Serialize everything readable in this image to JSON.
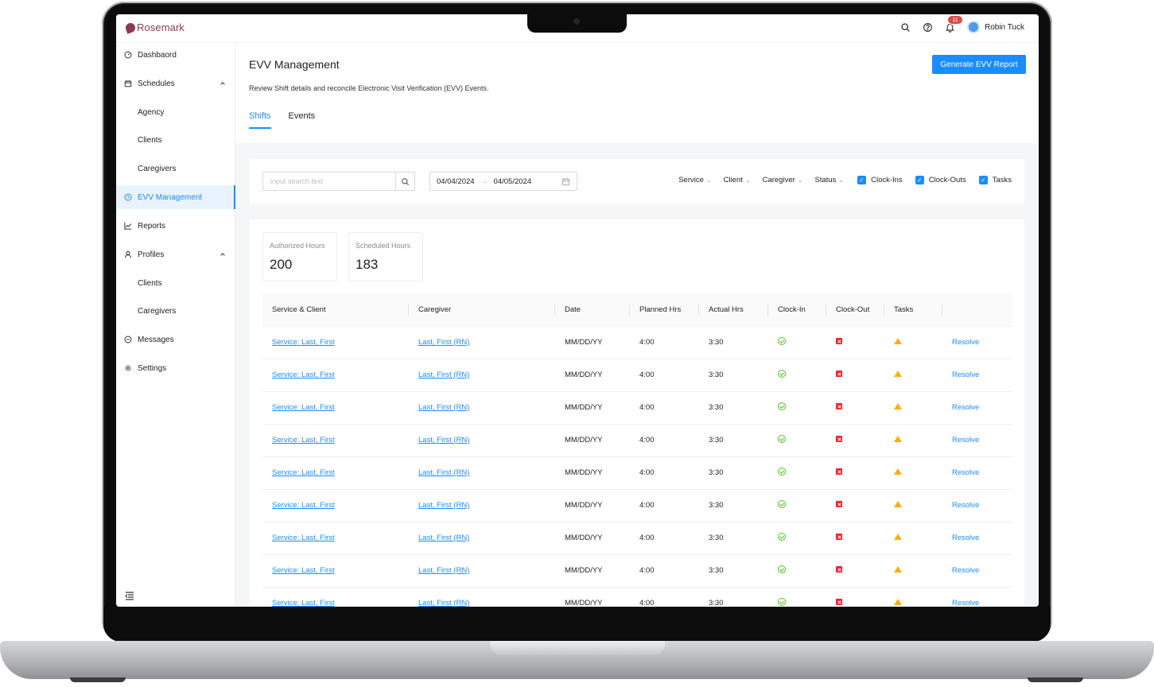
{
  "app": {
    "brand": "Rosemark"
  },
  "header": {
    "notification_count": "11",
    "user_name": "Robin Tuck"
  },
  "sidebar": {
    "items": [
      {
        "label": "Dashbaord",
        "icon": "dashboard-icon"
      },
      {
        "label": "Schedules",
        "icon": "calendar-icon",
        "expanded": true
      },
      {
        "label": "Agency",
        "sub": true
      },
      {
        "label": "Clients",
        "sub": true
      },
      {
        "label": "Caregivers",
        "sub": true
      },
      {
        "label": "EVV Management",
        "icon": "clock-icon",
        "active": true
      },
      {
        "label": "Reports",
        "icon": "chart-icon"
      },
      {
        "label": "Profiles",
        "icon": "user-icon",
        "expanded": true
      },
      {
        "label": "Clients",
        "sub": true
      },
      {
        "label": "Caregivers",
        "sub": true
      },
      {
        "label": "Messages",
        "icon": "message-icon"
      },
      {
        "label": "Settings",
        "icon": "gear-icon"
      }
    ]
  },
  "page": {
    "title": "EVV Management",
    "description": "Review Shift details and reconcile Electronic Visit Verification (EVV) Events.",
    "generate_button": "Generate EVV Report",
    "tabs": [
      "Shifts",
      "Events"
    ],
    "active_tab": "Shifts"
  },
  "filters": {
    "search_placeholder": "input search text",
    "date_start": "04/04/2024",
    "date_end": "04/05/2024",
    "dropdowns": [
      "Service",
      "Client",
      "Caregiver",
      "Status"
    ],
    "checkboxes": [
      {
        "label": "Clock-Ins",
        "checked": true
      },
      {
        "label": "Clock-Outs",
        "checked": true
      },
      {
        "label": "Tasks",
        "checked": true
      }
    ]
  },
  "stats": {
    "authorized": {
      "label": "Authorized Hours",
      "value": "200"
    },
    "scheduled": {
      "label": "Scheduled Hours",
      "value": "183"
    }
  },
  "table": {
    "columns": [
      "Service & Client",
      "Caregiver",
      "Date",
      "Planned Hrs",
      "Actual Hrs",
      "Clock-In",
      "Clock-Out",
      "Tasks",
      ""
    ],
    "rows": [
      {
        "service": "Service: Last, First",
        "caregiver": "Last, First (RN)",
        "date": "MM/DD/YY",
        "planned": "4:00",
        "actual": "3:30",
        "clock_in": "ok",
        "clock_out": "error",
        "tasks": "warning",
        "action": "Resolve"
      },
      {
        "service": "Service: Last, First",
        "caregiver": "Last, First (RN)",
        "date": "MM/DD/YY",
        "planned": "4:00",
        "actual": "3:30",
        "clock_in": "ok",
        "clock_out": "error",
        "tasks": "warning",
        "action": "Resolve"
      },
      {
        "service": "Service: Last, First",
        "caregiver": "Last, First (RN)",
        "date": "MM/DD/YY",
        "planned": "4:00",
        "actual": "3:30",
        "clock_in": "ok",
        "clock_out": "error",
        "tasks": "warning",
        "action": "Resolve"
      },
      {
        "service": "Service: Last, First",
        "caregiver": "Last, First (RN)",
        "date": "MM/DD/YY",
        "planned": "4:00",
        "actual": "3:30",
        "clock_in": "ok",
        "clock_out": "error",
        "tasks": "warning",
        "action": "Resolve"
      },
      {
        "service": "Service: Last, First",
        "caregiver": "Last, First (RN)",
        "date": "MM/DD/YY",
        "planned": "4:00",
        "actual": "3:30",
        "clock_in": "ok",
        "clock_out": "error",
        "tasks": "warning",
        "action": "Resolve"
      },
      {
        "service": "Service: Last, First",
        "caregiver": "Last, First (RN)",
        "date": "MM/DD/YY",
        "planned": "4:00",
        "actual": "3:30",
        "clock_in": "ok",
        "clock_out": "error",
        "tasks": "warning",
        "action": "Resolve"
      },
      {
        "service": "Service: Last, First",
        "caregiver": "Last, First (RN)",
        "date": "MM/DD/YY",
        "planned": "4:00",
        "actual": "3:30",
        "clock_in": "ok",
        "clock_out": "error",
        "tasks": "warning",
        "action": "Resolve"
      },
      {
        "service": "Service: Last, First",
        "caregiver": "Last, First (RN)",
        "date": "MM/DD/YY",
        "planned": "4:00",
        "actual": "3:30",
        "clock_in": "ok",
        "clock_out": "error",
        "tasks": "warning",
        "action": "Resolve"
      },
      {
        "service": "Service: Last, First",
        "caregiver": "Last, First (RN)",
        "date": "MM/DD/YY",
        "planned": "4:00",
        "actual": "3:30",
        "clock_in": "ok",
        "clock_out": "error",
        "tasks": "warning",
        "action": "Resolve"
      }
    ]
  },
  "colors": {
    "primary": "#1a8cff",
    "brand": "#8a3a56",
    "success": "#52c41a",
    "danger": "#f5222d",
    "warning": "#faad14"
  }
}
